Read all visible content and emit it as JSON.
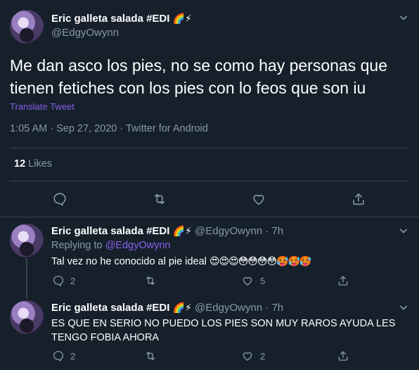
{
  "main_tweet": {
    "author_name": "Eric galleta salada #EDI",
    "badges": "🌈⚡",
    "handle": "@EdgyOwynn",
    "text": "Me dan asco los pies, no se como hay personas que tienen fetiches con los pies con lo feos que son iu",
    "translate": "Translate Tweet",
    "meta": "1:05 AM · Sep 27, 2020 · Twitter for Android",
    "likes_count": "12",
    "likes_label": "Likes"
  },
  "replies": [
    {
      "author_name": "Eric galleta salada #EDI",
      "badges": "🌈⚡",
      "handle_time": "@EdgyOwynn · 7h",
      "replying_label": "Replying to",
      "replying_to": "@EdgyOwynn",
      "text": "Tal vez no he conocido al pie ideal",
      "emojis": "😍😍😍😳😳😳😳🥵🥵🥵",
      "reply_count": "2",
      "like_count": "5"
    },
    {
      "author_name": "Eric galleta salada #EDI",
      "badges": "🌈⚡",
      "handle_time": "@EdgyOwynn · 7h",
      "text": "ES QUE EN SERIO NO PUEDO LOS PIES SON MUY RAROS AYUDA LES TENGO FOBIA AHORA",
      "reply_count": "2",
      "like_count": "2"
    }
  ],
  "colors": {
    "background": "#15202b",
    "secondary_text": "#8899a6",
    "accent": "#8a5eea",
    "divider": "#38444d"
  }
}
